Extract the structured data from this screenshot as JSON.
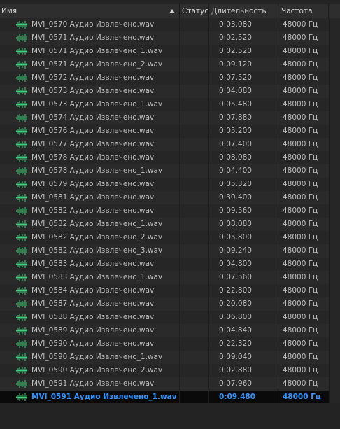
{
  "columns": {
    "name": "Имя",
    "status": "Статус",
    "duration": "Длительность",
    "rate": "Частота"
  },
  "colors": {
    "selected_text": "#2f96ff",
    "wave_icon": "#3fd07a"
  },
  "rows": [
    {
      "name": "MVI_0570 Аудио Извлечено.wav",
      "duration": "0:03.080",
      "rate": "48000 Гц"
    },
    {
      "name": "MVI_0571 Аудио Извлечено.wav",
      "duration": "0:02.520",
      "rate": "48000 Гц"
    },
    {
      "name": "MVI_0571 Аудио Извлечено_1.wav",
      "duration": "0:02.520",
      "rate": "48000 Гц"
    },
    {
      "name": "MVI_0571 Аудио Извлечено_2.wav",
      "duration": "0:09.120",
      "rate": "48000 Гц"
    },
    {
      "name": "MVI_0572 Аудио Извлечено.wav",
      "duration": "0:07.520",
      "rate": "48000 Гц"
    },
    {
      "name": "MVI_0573 Аудио Извлечено.wav",
      "duration": "0:04.080",
      "rate": "48000 Гц"
    },
    {
      "name": "MVI_0573 Аудио Извлечено_1.wav",
      "duration": "0:05.480",
      "rate": "48000 Гц"
    },
    {
      "name": "MVI_0574 Аудио Извлечено.wav",
      "duration": "0:07.880",
      "rate": "48000 Гц"
    },
    {
      "name": "MVI_0576 Аудио Извлечено.wav",
      "duration": "0:05.200",
      "rate": "48000 Гц"
    },
    {
      "name": "MVI_0577 Аудио Извлечено.wav",
      "duration": "0:07.400",
      "rate": "48000 Гц"
    },
    {
      "name": "MVI_0578 Аудио Извлечено.wav",
      "duration": "0:08.080",
      "rate": "48000 Гц"
    },
    {
      "name": "MVI_0578 Аудио Извлечено_1.wav",
      "duration": "0:04.400",
      "rate": "48000 Гц"
    },
    {
      "name": "MVI_0579 Аудио Извлечено.wav",
      "duration": "0:05.320",
      "rate": "48000 Гц"
    },
    {
      "name": "MVI_0581 Аудио Извлечено.wav",
      "duration": "0:30.400",
      "rate": "48000 Гц"
    },
    {
      "name": "MVI_0582 Аудио Извлечено.wav",
      "duration": "0:09.560",
      "rate": "48000 Гц"
    },
    {
      "name": "MVI_0582 Аудио Извлечено_1.wav",
      "duration": "0:08.080",
      "rate": "48000 Гц"
    },
    {
      "name": "MVI_0582 Аудио Извлечено_2.wav",
      "duration": "0:05.800",
      "rate": "48000 Гц"
    },
    {
      "name": "MVI_0582 Аудио Извлечено_3.wav",
      "duration": "0:09.240",
      "rate": "48000 Гц"
    },
    {
      "name": "MVI_0583 Аудио Извлечено.wav",
      "duration": "0:04.800",
      "rate": "48000 Гц"
    },
    {
      "name": "MVI_0583 Аудио Извлечено_1.wav",
      "duration": "0:07.560",
      "rate": "48000 Гц"
    },
    {
      "name": "MVI_0584 Аудио Извлечено.wav",
      "duration": "0:22.800",
      "rate": "48000 Гц"
    },
    {
      "name": "MVI_0587 Аудио Извлечено.wav",
      "duration": "0:20.080",
      "rate": "48000 Гц"
    },
    {
      "name": "MVI_0588 Аудио Извлечено.wav",
      "duration": "0:06.800",
      "rate": "48000 Гц"
    },
    {
      "name": "MVI_0589 Аудио Извлечено.wav",
      "duration": "0:04.840",
      "rate": "48000 Гц"
    },
    {
      "name": "MVI_0590 Аудио Извлечено.wav",
      "duration": "0:22.320",
      "rate": "48000 Гц"
    },
    {
      "name": "MVI_0590 Аудио Извлечено_1.wav",
      "duration": "0:09.040",
      "rate": "48000 Гц"
    },
    {
      "name": "MVI_0590 Аудио Извлечено_2.wav",
      "duration": "0:02.880",
      "rate": "48000 Гц"
    },
    {
      "name": "MVI_0591 Аудио Извлечено.wav",
      "duration": "0:07.960",
      "rate": "48000 Гц"
    },
    {
      "name": "MVI_0591 Аудио Извлечено_1.wav",
      "duration": "0:09.480",
      "rate": "48000 Гц",
      "selected": true
    }
  ]
}
